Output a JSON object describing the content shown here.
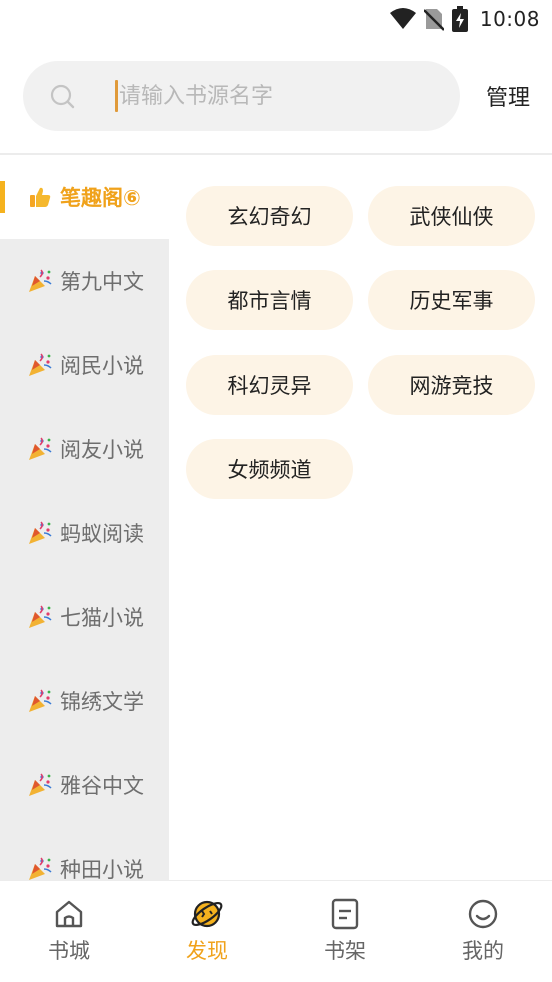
{
  "status_bar": {
    "time": "10:08",
    "icons": [
      "wifi-icon",
      "no-sim-icon",
      "battery-charging-icon"
    ]
  },
  "search": {
    "placeholder": "请输入书源名字",
    "value": "",
    "manage_label": "管理"
  },
  "sidebar": {
    "items": [
      {
        "label": "笔趣阁⑥",
        "icon": "thumbs-up-icon",
        "active": true
      },
      {
        "label": "第九中文",
        "icon": "party-popper-icon"
      },
      {
        "label": "阅民小说",
        "icon": "party-popper-icon"
      },
      {
        "label": "阅友小说",
        "icon": "party-popper-icon"
      },
      {
        "label": "蚂蚁阅读",
        "icon": "party-popper-icon"
      },
      {
        "label": "七猫小说",
        "icon": "party-popper-icon"
      },
      {
        "label": "锦绣文学",
        "icon": "party-popper-icon"
      },
      {
        "label": "雅谷中文",
        "icon": "party-popper-icon"
      },
      {
        "label": "种田小说",
        "icon": "party-popper-icon"
      }
    ]
  },
  "categories": [
    {
      "label": "玄幻奇幻"
    },
    {
      "label": "武侠仙侠"
    },
    {
      "label": "都市言情"
    },
    {
      "label": "历史军事"
    },
    {
      "label": "科幻灵异"
    },
    {
      "label": "网游竞技"
    },
    {
      "label": "女频频道"
    }
  ],
  "bottom_nav": {
    "items": [
      {
        "label": "书城",
        "icon": "home-icon"
      },
      {
        "label": "发现",
        "icon": "planet-icon",
        "active": true
      },
      {
        "label": "书架",
        "icon": "bookshelf-icon"
      },
      {
        "label": "我的",
        "icon": "smile-icon"
      }
    ]
  },
  "colors": {
    "accent": "#f0a21b",
    "tag_bg": "#fdf4e6",
    "sidebar_bg": "#ededed"
  }
}
